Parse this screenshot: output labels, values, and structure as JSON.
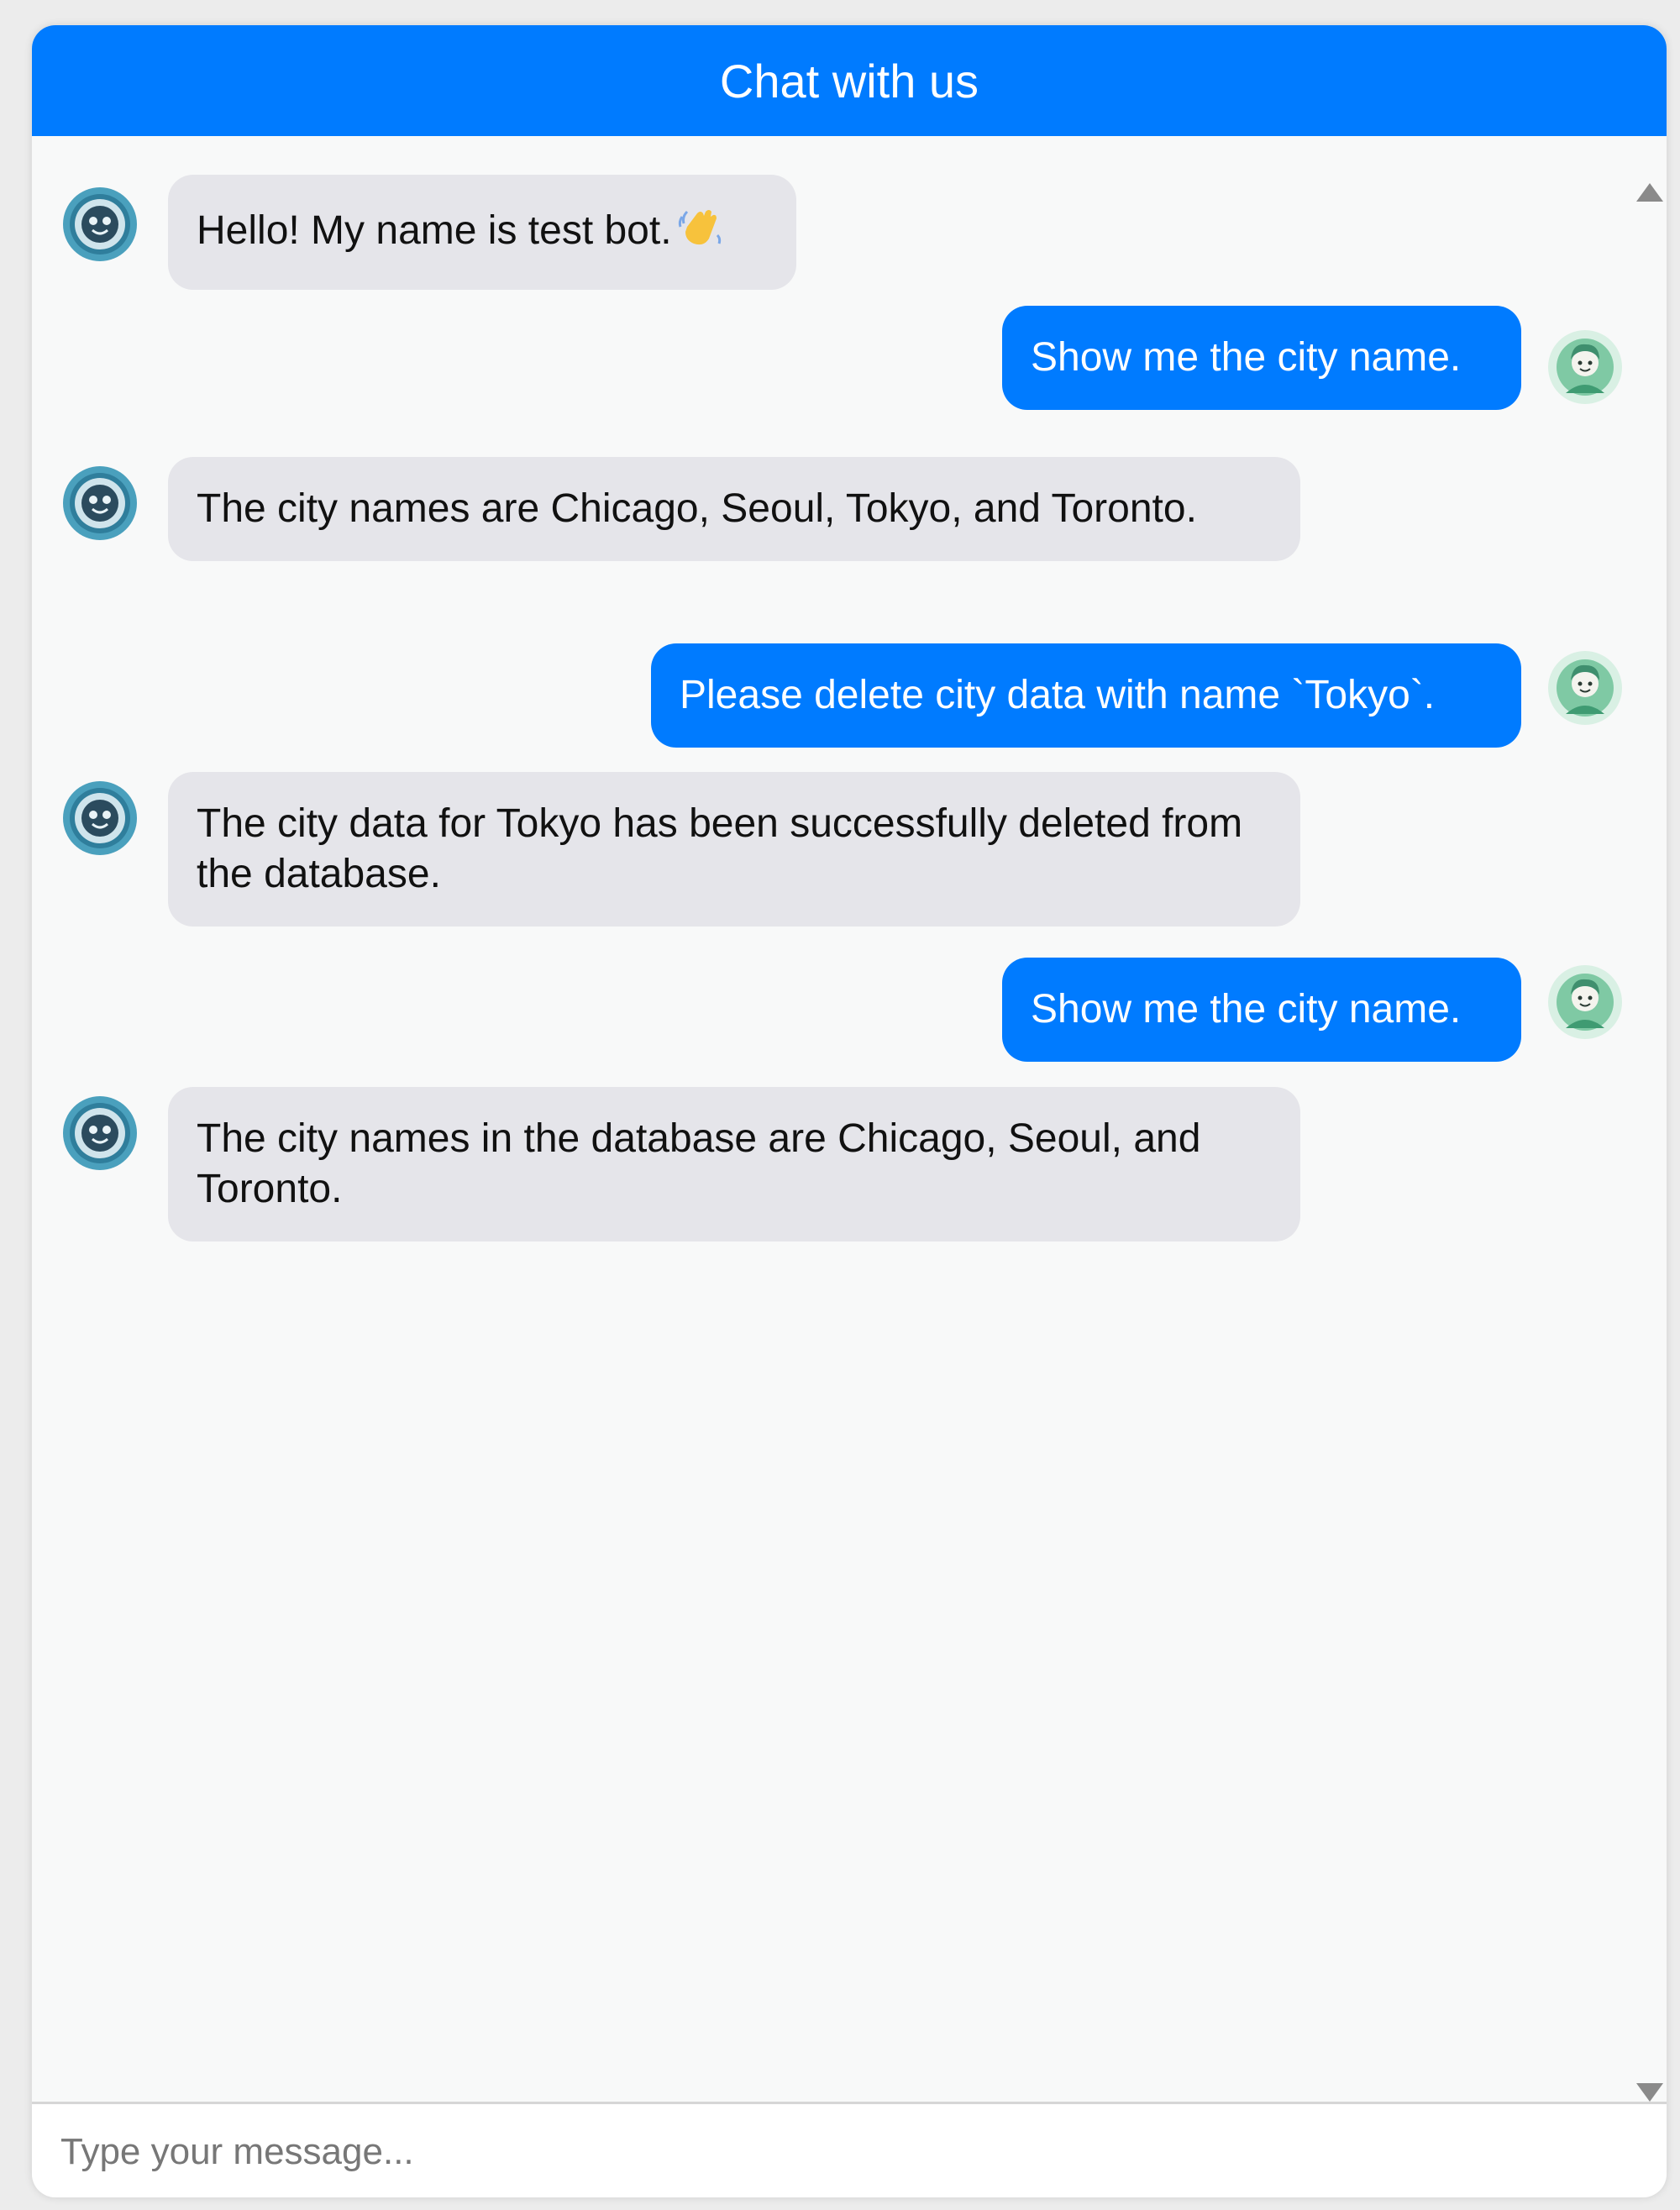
{
  "header": {
    "title": "Chat with us"
  },
  "messages": [
    {
      "role": "bot",
      "text": "Hello! My name is test bot.",
      "emoji": "waving-hand"
    },
    {
      "role": "user",
      "text": "Show me the city name."
    },
    {
      "role": "bot",
      "text": "The city names are Chicago, Seoul, Tokyo, and Toronto."
    },
    {
      "role": "user",
      "text": "Please delete city data with name `Tokyo`."
    },
    {
      "role": "bot",
      "text": "The city data for Tokyo has been successfully deleted from the database."
    },
    {
      "role": "user",
      "text": "Show me the city name."
    },
    {
      "role": "bot",
      "text": "The city names in the database are Chicago, Seoul, and Toronto."
    }
  ],
  "input": {
    "placeholder": "Type your message..."
  },
  "colors": {
    "header": "#007bff",
    "user_bubble": "#007bff",
    "bot_bubble": "#e5e5ea",
    "background": "#f8f9f9"
  },
  "icons": {
    "bot_avatar": "robot-face-icon",
    "user_avatar": "user-face-icon",
    "scroll_up": "triangle-up-icon",
    "scroll_down": "triangle-down-icon"
  }
}
